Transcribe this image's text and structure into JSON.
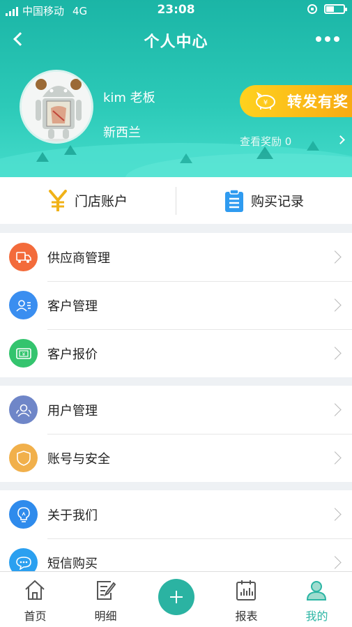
{
  "status_bar": {
    "carrier": "中国移动",
    "network": "4G",
    "time": "23:08"
  },
  "header": {
    "title": "个人中心"
  },
  "profile": {
    "name": "kim 老板",
    "region": "新西兰",
    "avatar_caption": "アンドロイド"
  },
  "share": {
    "label": "转发有奖",
    "reward_label": "查看奖励 0"
  },
  "quick_actions": [
    {
      "label": "门店账户",
      "icon": "yuan-icon"
    },
    {
      "label": "购买记录",
      "icon": "clipboard-icon"
    }
  ],
  "menu_groups": [
    [
      {
        "label": "供应商管理",
        "icon": "truck-icon",
        "color": "#f36b3b"
      },
      {
        "label": "客户管理",
        "icon": "customers-icon",
        "color": "#3a8ef0"
      },
      {
        "label": "客户报价",
        "icon": "quote-icon",
        "color": "#34c46e"
      }
    ],
    [
      {
        "label": "用户管理",
        "icon": "users-icon",
        "color": "#6f86c8"
      },
      {
        "label": "账号与安全",
        "icon": "shield-icon",
        "color": "#f1b04b"
      }
    ],
    [
      {
        "label": "关于我们",
        "icon": "lightbulb-icon",
        "color": "#2f8bec"
      },
      {
        "label": "短信购买",
        "icon": "sms-icon",
        "color": "#2ba0f0"
      }
    ]
  ],
  "tabs": [
    {
      "label": "首页",
      "icon": "home-icon"
    },
    {
      "label": "明细",
      "icon": "edit-note-icon"
    },
    {
      "label": "",
      "icon": "plus-icon"
    },
    {
      "label": "报表",
      "icon": "calendar-chart-icon"
    },
    {
      "label": "我的",
      "icon": "person-icon",
      "active": true
    }
  ],
  "colors": {
    "primary": "#2bb5a4",
    "accent": "#f7a812"
  },
  "battery_level": 0.45
}
